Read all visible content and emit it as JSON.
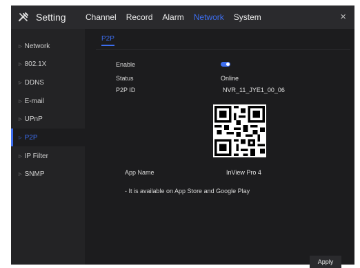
{
  "window": {
    "title": "Setting",
    "close_symbol": "×"
  },
  "tabs": [
    {
      "label": "Channel"
    },
    {
      "label": "Record"
    },
    {
      "label": "Alarm"
    },
    {
      "label": "Network",
      "active": true
    },
    {
      "label": "System"
    }
  ],
  "sidebar": {
    "items": [
      {
        "label": "Network"
      },
      {
        "label": "802.1X"
      },
      {
        "label": "DDNS"
      },
      {
        "label": "E-mail"
      },
      {
        "label": "UPnP"
      },
      {
        "label": "P2P",
        "active": true
      },
      {
        "label": "IP Filter"
      },
      {
        "label": "SNMP"
      }
    ]
  },
  "main": {
    "subtab": "P2P",
    "enable_label": "Enable",
    "enable_on": true,
    "status_label": "Status",
    "status_value": "Online",
    "p2p_id_label": "P2P ID",
    "p2p_id_value": "NVR_11_JYE1_00_06",
    "app_name_label": "App Name",
    "app_name_value": "InView Pro 4",
    "note": "- It is available on App Store and Google Play",
    "qr_icon": "qr-code"
  },
  "footer": {
    "apply_label": "Apply"
  },
  "colors": {
    "accent": "#3d6ef0",
    "background": "#1c1c1e",
    "titlebar": "#2a2a2d",
    "sidebar": "#232325"
  }
}
